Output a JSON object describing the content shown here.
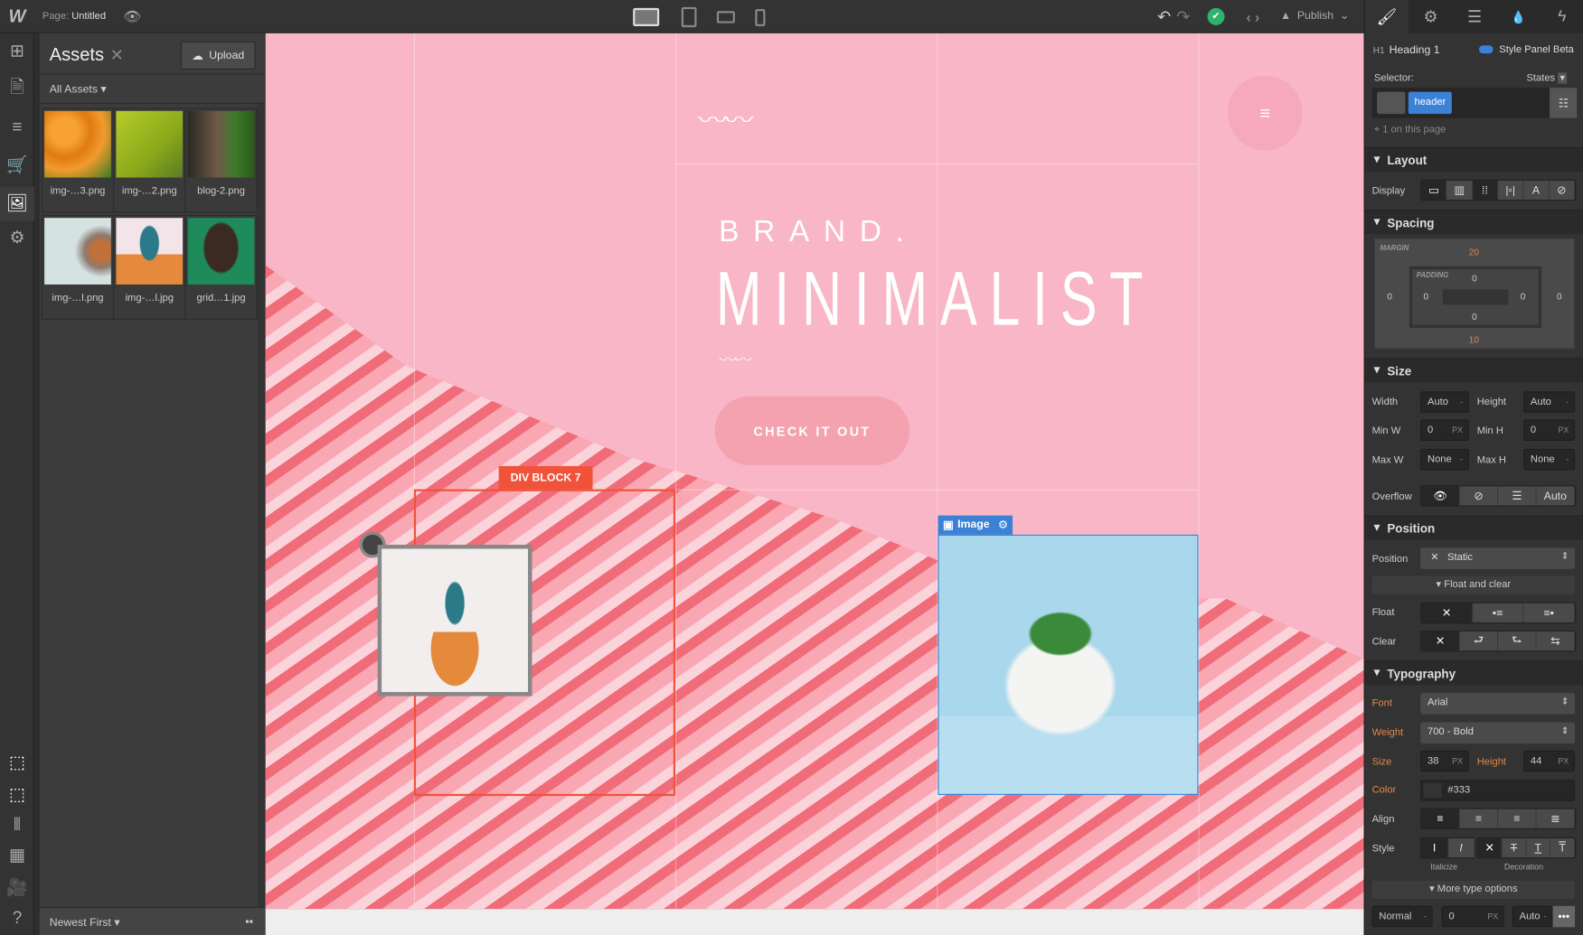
{
  "topbar": {
    "page_label": "Page:",
    "page_name": "Untitled",
    "publish": "Publish"
  },
  "assets": {
    "title": "Assets",
    "upload": "Upload",
    "filter": "All Assets",
    "sort": "Newest First",
    "items": [
      {
        "name": "img-…3.png"
      },
      {
        "name": "img-…2.png"
      },
      {
        "name": "blog-2.png"
      },
      {
        "name": "img-…l.png"
      },
      {
        "name": "img-…l.jpg"
      },
      {
        "name": "grid…1.jpg"
      }
    ]
  },
  "canvas": {
    "brand": "BRAND.",
    "headline": "MINIMALIST",
    "cta": "CHECK IT OUT",
    "div_label": "DIV BLOCK 7",
    "image_label": "Image"
  },
  "panel": {
    "element_tag": "H1",
    "element_name": "Heading 1",
    "style_beta": "Style Panel Beta",
    "selector_label": "Selector:",
    "states": "States",
    "class_chip": "header",
    "on_page": "1 on this page",
    "layout": {
      "title": "Layout",
      "display": "Display"
    },
    "spacing": {
      "title": "Spacing",
      "margin": "MARGIN",
      "padding": "PADDING",
      "margin_top": "20",
      "margin_bottom": "10",
      "margin_left": "0",
      "margin_right": "0",
      "padding_top": "0",
      "padding_bottom": "0",
      "padding_left": "0",
      "padding_right": "0"
    },
    "size": {
      "title": "Size",
      "width": "Width",
      "width_v": "Auto",
      "height": "Height",
      "height_v": "Auto",
      "minw": "Min W",
      "minw_v": "0",
      "minh": "Min H",
      "minh_v": "0",
      "maxw": "Max W",
      "maxw_v": "None",
      "maxh": "Max H",
      "maxh_v": "None",
      "px": "PX",
      "dash": "-",
      "overflow": "Overflow",
      "auto": "Auto"
    },
    "position": {
      "title": "Position",
      "position": "Position",
      "value": "Static",
      "float_clear": "Float and clear",
      "float": "Float",
      "clear": "Clear"
    },
    "typography": {
      "title": "Typography",
      "font": "Font",
      "font_v": "Arial",
      "weight": "Weight",
      "weight_v": "700 - Bold",
      "size": "Size",
      "size_v": "38",
      "height": "Height",
      "height_v": "44",
      "color": "Color",
      "color_v": "#333",
      "align": "Align",
      "style": "Style",
      "italicize": "Italicize",
      "decoration": "Decoration",
      "more": "More type options",
      "spacing_v": "Normal",
      "indent_v": "0",
      "columns_v": "Auto"
    }
  },
  "colors": {
    "accent": "#3b82d6",
    "div_outline": "#f0533a",
    "publish_ok": "#2fb36a"
  }
}
